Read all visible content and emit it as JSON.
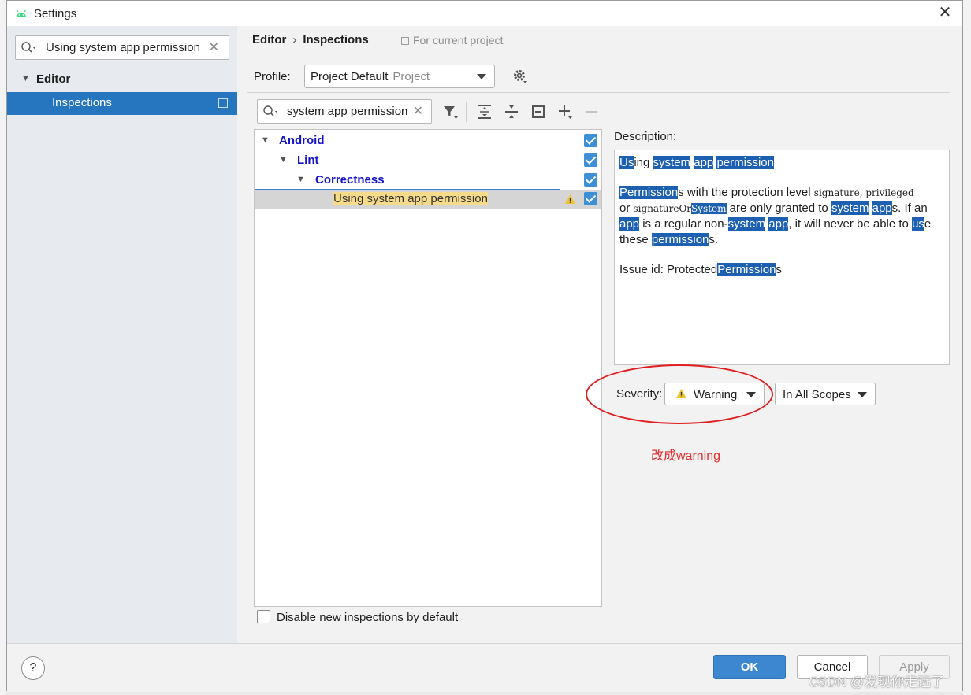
{
  "window": {
    "title": "Settings",
    "close_glyph": "✕"
  },
  "sidebar": {
    "search_value": "Using system app permission",
    "clear_glyph": "✕",
    "items": [
      {
        "label": "Editor"
      },
      {
        "label": "Inspections"
      }
    ]
  },
  "breadcrumb": {
    "root": "Editor",
    "sep": "›",
    "current": "Inspections",
    "scope_hint": "For current project"
  },
  "profile": {
    "label": "Profile:",
    "value": "Project Default",
    "type": "Project"
  },
  "tree": {
    "search_value": "system app permission",
    "clear_glyph": "✕",
    "nodes": [
      {
        "label": "Android"
      },
      {
        "label": "Lint"
      },
      {
        "label": "Correctness"
      }
    ],
    "selected_item": {
      "w1": "Using",
      "w2": "system",
      "w3": "app",
      "w4": "permission"
    }
  },
  "disable_new": {
    "label": "Disable new inspections by default"
  },
  "description": {
    "label": "Description:",
    "title": {
      "a": "Us",
      "b": "ing",
      "c": "system",
      "d": "app",
      "e": "permission"
    },
    "p1": {
      "a": "Permission",
      "b": "s with the protection level ",
      "c": "signature",
      "d": ", ",
      "e": "privileged",
      "f": "or ",
      "g": "signatureOr",
      "h": "System",
      "i": " are only granted to ",
      "j": "system",
      "k": "app",
      "l": "s. If an",
      "m": "app",
      "n": " is a regular non-",
      "o": "system",
      "p": "app",
      "q": ", it will never be able to ",
      "r": "us",
      "s": "e",
      "t": "these ",
      "u": "permission",
      "v": "s."
    },
    "issue": {
      "a": "Issue id: Protected",
      "b": "Permission",
      "c": "s"
    }
  },
  "severity": {
    "label": "Severity:",
    "value": "Warning",
    "scope": "In All Scopes"
  },
  "annotation": "改成warning",
  "footer": {
    "help": "?",
    "ok": "OK",
    "cancel": "Cancel",
    "apply": "Apply"
  },
  "watermark": "CSDN @发现你走远了",
  "colors": {
    "accent": "#2675bf",
    "highlight": "#1d5fb1",
    "match": "#f6dc8a",
    "annotation": "#e03030",
    "tree_group": "#1414c8"
  }
}
